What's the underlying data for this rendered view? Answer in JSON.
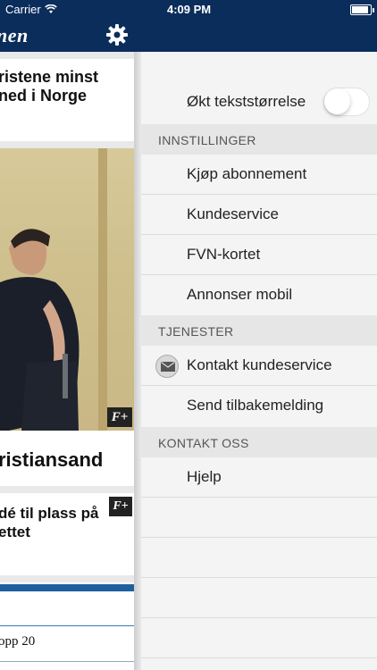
{
  "status_bar": {
    "carrier": "Carrier",
    "time": "4:09 PM"
  },
  "content": {
    "logo": "nen",
    "articles": [
      {
        "title_line1": "ristene minst",
        "title_line2": "ned i Norge"
      },
      {
        "title": "ristiansand",
        "badge": "F+"
      },
      {
        "title_line1": "dé til plass på",
        "title_line2": "ettet",
        "badge": "F+"
      },
      {
        "item": "opp 20"
      }
    ],
    "photo_badge": "F+"
  },
  "menu": {
    "text_size_toggle_label": "Økt tekststørrelse",
    "text_size_enabled": false,
    "sections": [
      {
        "header": "INNSTILLINGER",
        "items": [
          "Kjøp abonnement",
          "Kundeservice",
          "FVN-kortet",
          "Annonser mobil"
        ]
      },
      {
        "header": "TJENESTER",
        "items": [
          "Kontakt kundeservice",
          "Send tilbakemelding"
        ]
      },
      {
        "header": "KONTAKT OSS",
        "items": [
          "Hjelp"
        ]
      }
    ],
    "icons": {
      "gear": "gear-icon",
      "mail": "mail-icon"
    }
  },
  "colors": {
    "navbar": "#0b2d5b",
    "accent": "#1f5f9e"
  }
}
